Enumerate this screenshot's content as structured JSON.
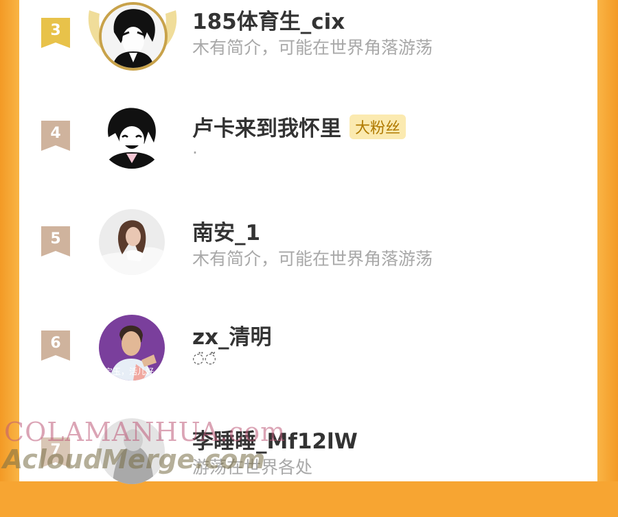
{
  "ranking": [
    {
      "rank": "3",
      "name": "185体育生_cix",
      "badge": "",
      "desc": "木有简介，可能在世界角落游荡",
      "avatar": "anime-boy-avatar",
      "frame": "gold-laurel"
    },
    {
      "rank": "4",
      "name": "卢卡来到我怀里",
      "badge": "大粉丝",
      "desc": "·",
      "avatar": "anime-boy-smiling-avatar"
    },
    {
      "rank": "5",
      "name": "南安_1",
      "badge": "",
      "desc": "木有简介，可能在世界角落游荡",
      "avatar": "girl-photo-avatar"
    },
    {
      "rank": "6",
      "name": "zx_清明",
      "badge": "",
      "desc": "◌̈◌̃",
      "avatar": "man-photo-avatar",
      "avatar_caption": "宝玉，活儿好"
    },
    {
      "rank": "7",
      "name": "李睡睡_Mf12lW",
      "badge": "",
      "desc": "游荡在世界各处",
      "avatar": "photo-avatar"
    }
  ],
  "watermark": {
    "line1": "COLAMANHUA.com",
    "line2": "AcloudMerge.com"
  },
  "colors": {
    "background": "#f7a532",
    "panel": "#ffffff",
    "rank_top": "#e8c24a",
    "rank_other": "#cfb39d",
    "name": "#333333",
    "desc": "#a8a8a8",
    "badge_bg": "#fbeab0",
    "badge_text": "#b07a00"
  }
}
